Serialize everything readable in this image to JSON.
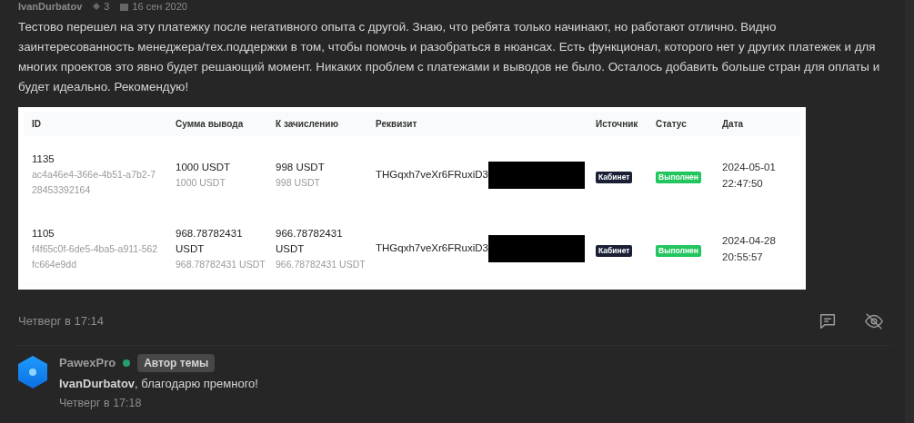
{
  "post": {
    "author": "IvanDurbatov",
    "reputation": "3",
    "joined": "16 сен 2020",
    "body": "Тестово перешел на эту платежку после негативного опыта с другой. Знаю, что ребята только начинают, но работают отлично. Видно заинтересованность менеджера/тех.поддержки в том, чтобы помочь и разобраться в нюансах. Есть функционал, которого нет у других платежек и для многих проектов это явно будет решающий момент. Никаких проблем с платежами и выводов не было. Осталось добавить больше стран для оплаты и будет идеально. Рекомендую!",
    "table": {
      "columns": [
        "ID",
        "Сумма вывода",
        "К зачислению",
        "Реквизит",
        "Источник",
        "Статус",
        "Дата"
      ],
      "rows": [
        {
          "id": "1135",
          "uuid": "ac4a46e4-366e-4b51-a7b2-728453392164",
          "amount": "1000 USDT",
          "amount_sub": "1000 USDT",
          "credit": "998 USDT",
          "credit_sub": "998 USDT",
          "requisite": "THGqxh7veXr6FRuxiD3",
          "source": "Кабинет",
          "status": "Выполнен",
          "date": "2024-05-01",
          "time": "22:47:50"
        },
        {
          "id": "1105",
          "uuid": "f4f65c0f-6de5-4ba5-a911-562fc664e9dd",
          "amount": "968.78782431 USDT",
          "amount_sub": "968.78782431 USDT",
          "credit": "966.78782431 USDT",
          "credit_sub": "966.78782431 USDT",
          "requisite": "THGqxh7veXr6FRuxiD3",
          "source": "Кабинет",
          "status": "Выполнен",
          "date": "2024-04-28",
          "time": "20:55:57"
        }
      ]
    },
    "time": "Четверг в 17:14"
  },
  "reply": {
    "author": "PawexPro",
    "online": true,
    "badge": "Автор темы",
    "text": "**IvanDurbatov**, благодарю премного!",
    "time": "Четверг в 17:18"
  }
}
